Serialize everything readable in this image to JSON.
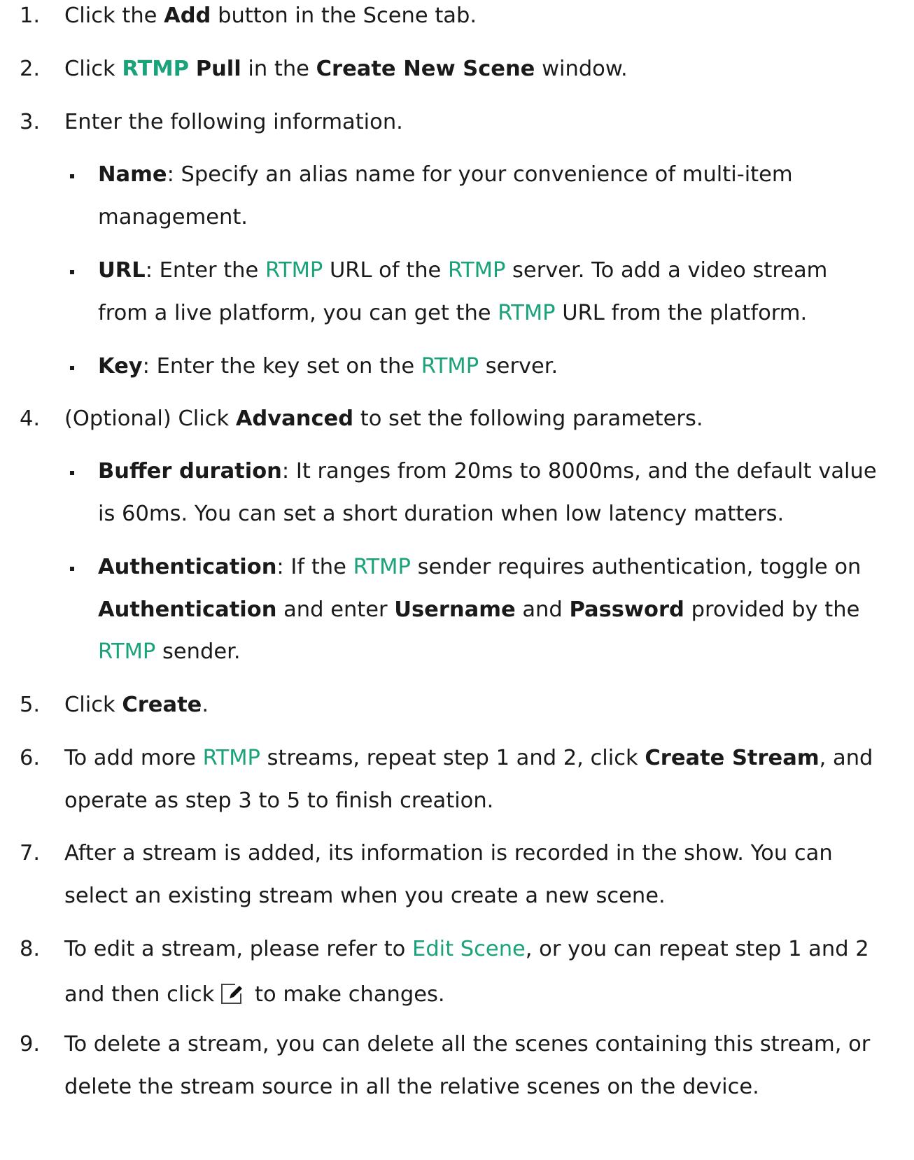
{
  "steps": {
    "s1": {
      "num": "1.",
      "a": "Click the ",
      "b": "Add",
      "c": " button in the Scene tab."
    },
    "s2": {
      "num": "2.",
      "a": "Click ",
      "g": "RTMP",
      "sp": " ",
      "b": "Pull",
      "c": " in the ",
      "d": "Create New Scene",
      "e": " window."
    },
    "s3": {
      "num": "3.",
      "a": "Enter the following information."
    },
    "s3_name": {
      "b": "Name",
      "a": ": Specify an alias name for your convenience of multi-item",
      "line2": "management."
    },
    "s3_url": {
      "b": "URL",
      "a": ": Enter the ",
      "g1": "RTMP",
      "c": " URL of the ",
      "g2": "RTMP",
      "d": " server. To add a video stream",
      "e": "from a live platform, you can get the ",
      "g3": "RTMP",
      "f": " URL from the platform."
    },
    "s3_key": {
      "b": "Key",
      "a": ": Enter the key set on the ",
      "g": "RTMP",
      "c": " server."
    },
    "s4": {
      "num": "4.",
      "a": "(Optional) Click ",
      "b": "Advanced",
      "c": " to set the following parameters."
    },
    "s4_buffer": {
      "b": "Buffer duration",
      "a": ": It ranges from 20ms to 8000ms, and the default value",
      "line2": "is 60ms. You can set a short duration when low latency matters."
    },
    "s4_auth": {
      "b": "Authentication",
      "a": ": If the ",
      "g1": "RTMP",
      "c": " sender requires authentication, toggle on",
      "b2": "Authentication",
      "d": " and enter ",
      "b3": "Username",
      "e": " and ",
      "b4": "Password",
      "f": " provided by the",
      "g2": "RTMP",
      "h": " sender."
    },
    "s5": {
      "num": "5.",
      "a": "Click ",
      "b": "Create",
      "c": "."
    },
    "s6": {
      "num": "6.",
      "a": "To add more ",
      "g": "RTMP",
      "c": " streams, repeat step 1 and 2, click ",
      "b": "Create Stream",
      "d": ", and",
      "line2": "operate as step 3 to 5 to finish creation."
    },
    "s7": {
      "num": "7.",
      "a": "After a stream is added, its information is recorded in the show. You can",
      "line2": "select an existing stream when you create a new scene."
    },
    "s8": {
      "num": "8.",
      "a": "To edit a stream, please refer to ",
      "link": "Edit Scene",
      "c": ", or you can repeat step 1 and 2",
      "d": "and then click",
      "e": " to make changes."
    },
    "s9": {
      "num": "9.",
      "a": "To delete a stream, you can delete all the scenes containing this stream, or",
      "line2": "delete the stream source in all the relative scenes on the device."
    }
  },
  "colors": {
    "accent": "#1aa37a",
    "text": "#1a1a1a"
  }
}
